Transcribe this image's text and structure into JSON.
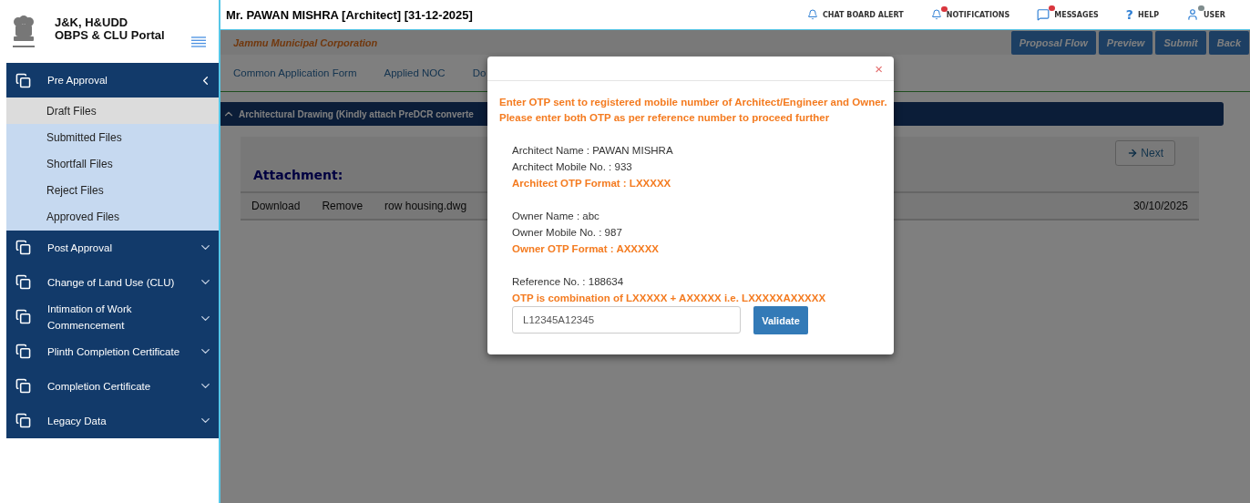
{
  "sidebar": {
    "title": "J&K, H&UDD",
    "subtitle": "OBPS & CLU Portal",
    "menu": [
      {
        "label": "Pre Approval",
        "expanded": true,
        "children": [
          {
            "label": "Draft Files",
            "selected": true
          },
          {
            "label": "Submitted Files",
            "selected": false
          },
          {
            "label": "Shortfall Files",
            "selected": false
          },
          {
            "label": "Reject Files",
            "selected": false
          },
          {
            "label": "Approved Files",
            "selected": false
          }
        ]
      },
      {
        "label": "Post Approval",
        "expanded": false
      },
      {
        "label": "Change of Land Use (CLU)",
        "expanded": false
      },
      {
        "label": "Intimation of Work Commencement",
        "expanded": false
      },
      {
        "label": "Plinth Completion Certificate",
        "expanded": false
      },
      {
        "label": "Completion Certificate",
        "expanded": false
      },
      {
        "label": "Legacy Data",
        "expanded": false
      }
    ]
  },
  "header": {
    "user": "Mr. PAWAN MISHRA [Architect] [31-12-2025]",
    "links": [
      {
        "kind": "bell",
        "label": "CHAT BOARD ALERT"
      },
      {
        "kind": "bell",
        "label": "NOTIFICATIONS",
        "color": "#d9363e"
      },
      {
        "kind": "chat",
        "label": "MESSAGES",
        "color": "#d9363e"
      },
      {
        "kind": "help",
        "glyph": "?",
        "label": "HELP"
      },
      {
        "kind": "user",
        "label": "USER",
        "color": "#7f8c8d"
      }
    ]
  },
  "org_bar": {
    "title": "Jammu Municipal Corporation",
    "buttons": [
      "Proposal Flow",
      "Preview",
      "Submit",
      "Back"
    ]
  },
  "tabs": [
    "Common Application Form",
    "Applied NOC",
    "Do"
  ],
  "section": {
    "title": "Architectural Drawing (Kindly attach PreDCR converte",
    "expanded": true
  },
  "attachments": {
    "next_button": "Next",
    "heading": "Attachment:",
    "rows": [
      {
        "actions": [
          "Download",
          "Remove"
        ],
        "file": "row housing.dwg",
        "date": "30/10/2025"
      }
    ]
  },
  "modal": {
    "close": "×",
    "instructions": [
      "Enter OTP sent to registered mobile number of Architect/Engineer and Owner.",
      "Please enter both OTP as per reference number to proceed further"
    ],
    "groups": [
      [
        {
          "kind": "info",
          "text": "Architect Name : PAWAN MISHRA"
        },
        {
          "kind": "info",
          "text": "Architect Mobile No. : 933"
        },
        {
          "kind": "hint",
          "text": "Architect OTP Format : LXXXXX"
        }
      ],
      [
        {
          "kind": "info",
          "text": "Owner Name : abc"
        },
        {
          "kind": "info",
          "text": "Owner Mobile No. : 987"
        },
        {
          "kind": "hint",
          "text": "Owner OTP Format : AXXXXX"
        }
      ],
      [
        {
          "kind": "info",
          "text": "Reference No. : 188634"
        },
        {
          "kind": "hint",
          "text": "OTP is combination of LXXXXX + AXXXXX i.e. LXXXXXAXXXXX"
        }
      ]
    ],
    "otp_field": {
      "value": "L12345A12345"
    },
    "validate_button": "Validate"
  }
}
